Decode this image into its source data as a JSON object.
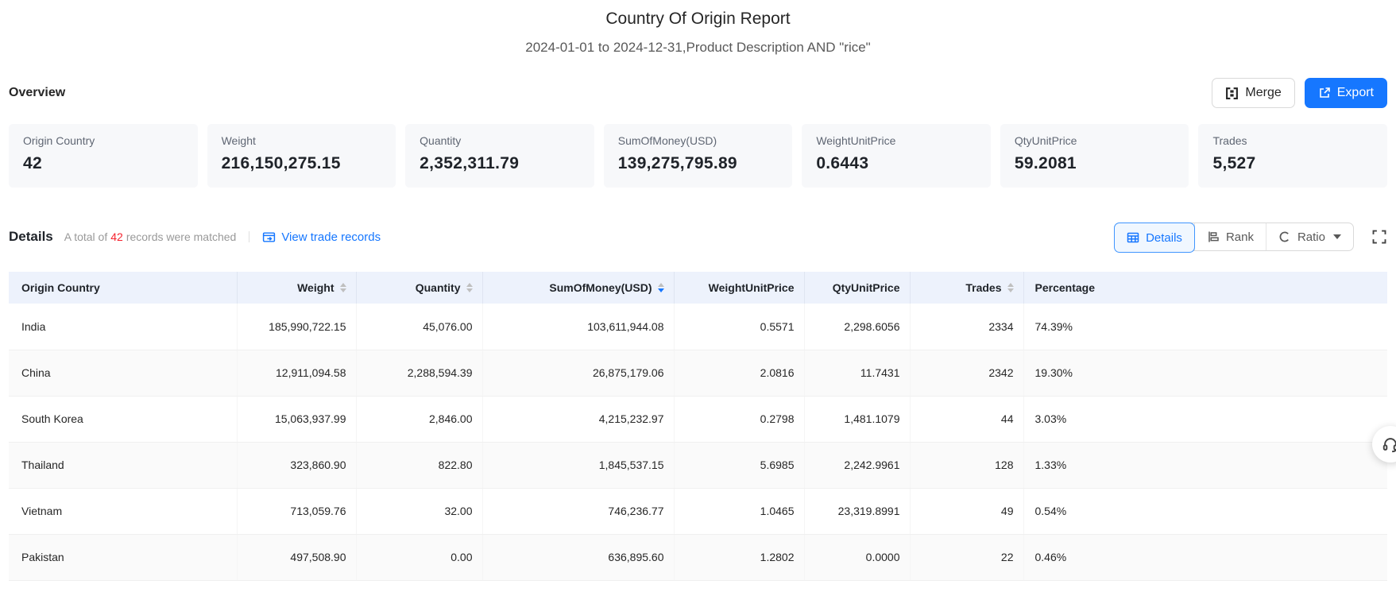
{
  "report": {
    "title": "Country Of Origin Report",
    "subtitle": "2024-01-01 to 2024-12-31,Product Description AND \"rice\""
  },
  "overview": {
    "label": "Overview",
    "merge_label": "Merge",
    "export_label": "Export",
    "cards": [
      {
        "label": "Origin Country",
        "value": "42"
      },
      {
        "label": "Weight",
        "value": "216,150,275.15"
      },
      {
        "label": "Quantity",
        "value": "2,352,311.79"
      },
      {
        "label": "SumOfMoney(USD)",
        "value": "139,275,795.89"
      },
      {
        "label": "WeightUnitPrice",
        "value": "0.6443"
      },
      {
        "label": "QtyUnitPrice",
        "value": "59.2081"
      },
      {
        "label": "Trades",
        "value": "5,527"
      }
    ]
  },
  "details": {
    "label": "Details",
    "total_prefix": "A total of",
    "total_count": "42",
    "total_suffix": "records were matched",
    "view_link": "View trade records",
    "tabs": [
      {
        "label": "Details",
        "active": true
      },
      {
        "label": "Rank",
        "active": false
      },
      {
        "label": "Ratio",
        "active": false,
        "has_dropdown": true
      }
    ]
  },
  "icons": {
    "merge": "merge-cells",
    "export": "external-link",
    "view_records": "window-link",
    "tab_details": "table-grid",
    "tab_rank": "rank-bars",
    "tab_ratio": "ratio-circle",
    "ratio_caret": "caret-down",
    "fullscreen": "expand-corners",
    "sorter": "caret-up-down",
    "support": "headset"
  },
  "colors": {
    "accent": "#1677ff",
    "count_red": "#f5222d",
    "header_bg": "#edf2fc",
    "card_bg": "#f7f8fa",
    "stripe": "#fafafa"
  },
  "table": {
    "columns": [
      {
        "label": "Origin Country",
        "align": "left",
        "sortable": false,
        "sorted": null
      },
      {
        "label": "Weight",
        "align": "right",
        "sortable": true,
        "sorted": null
      },
      {
        "label": "Quantity",
        "align": "right",
        "sortable": true,
        "sorted": null
      },
      {
        "label": "SumOfMoney(USD)",
        "align": "right",
        "sortable": true,
        "sorted": "desc"
      },
      {
        "label": "WeightUnitPrice",
        "align": "right",
        "sortable": false,
        "sorted": null
      },
      {
        "label": "QtyUnitPrice",
        "align": "right",
        "sortable": false,
        "sorted": null
      },
      {
        "label": "Trades",
        "align": "right",
        "sortable": true,
        "sorted": null
      },
      {
        "label": "Percentage",
        "align": "left",
        "sortable": false,
        "sorted": null
      }
    ],
    "rows": [
      [
        "India",
        "185,990,722.15",
        "45,076.00",
        "103,611,944.08",
        "0.5571",
        "2,298.6056",
        "2334",
        "74.39%"
      ],
      [
        "China",
        "12,911,094.58",
        "2,288,594.39",
        "26,875,179.06",
        "2.0816",
        "11.7431",
        "2342",
        "19.30%"
      ],
      [
        "South Korea",
        "15,063,937.99",
        "2,846.00",
        "4,215,232.97",
        "0.2798",
        "1,481.1079",
        "44",
        "3.03%"
      ],
      [
        "Thailand",
        "323,860.90",
        "822.80",
        "1,845,537.15",
        "5.6985",
        "2,242.9961",
        "128",
        "1.33%"
      ],
      [
        "Vietnam",
        "713,059.76",
        "32.00",
        "746,236.77",
        "1.0465",
        "23,319.8991",
        "49",
        "0.54%"
      ],
      [
        "Pakistan",
        "497,508.90",
        "0.00",
        "636,895.60",
        "1.2802",
        "0.0000",
        "22",
        "0.46%"
      ]
    ]
  }
}
